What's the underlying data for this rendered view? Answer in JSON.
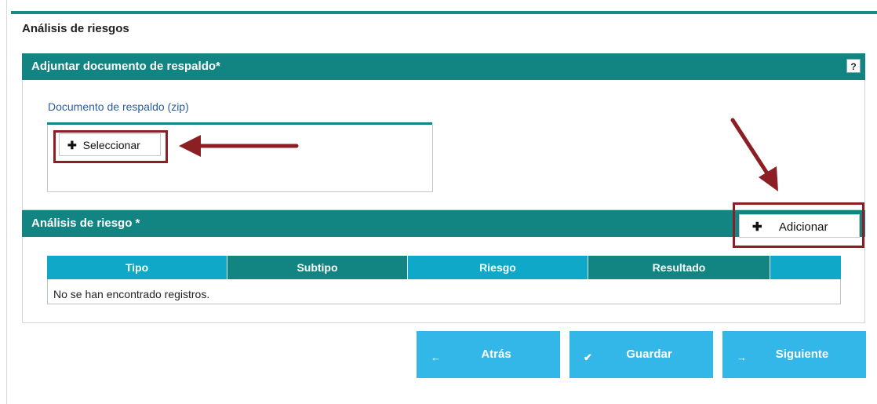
{
  "page": {
    "title": "Análisis de riesgos"
  },
  "attachment_section": {
    "header": "Adjuntar documento de respaldo*",
    "help_label": "?",
    "doc_label": "Documento de respaldo (zip)",
    "select_plus": "✚",
    "select_label": "Seleccionar"
  },
  "risk_section": {
    "header": "Análisis de riesgo *",
    "add_plus": "✚",
    "add_label": "Adicionar",
    "columns": [
      "Tipo",
      "Subtipo",
      "Riesgo",
      "Resultado",
      ""
    ],
    "empty_message": "No se han encontrado registros."
  },
  "nav": {
    "back_icon": "←",
    "back_label": "Atrás",
    "save_icon": "✔",
    "save_label": "Guardar",
    "next_icon": "→",
    "next_label": "Siguiente"
  },
  "colors": {
    "teal_header": "#128482",
    "light_blue_column": "#0fa8c8",
    "nav_button": "#33b7e8",
    "highlight_red": "#8b1f24"
  }
}
